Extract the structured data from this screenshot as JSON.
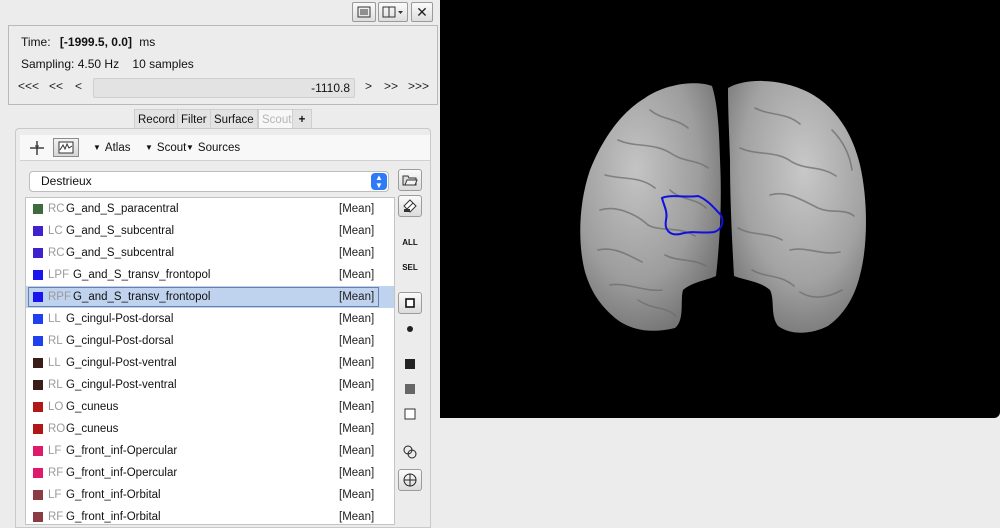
{
  "time_panel": {
    "time_label": "Time:",
    "time_value": "[-1999.5, 0.0]",
    "time_unit": "ms",
    "sampling_label": "Sampling:",
    "sampling_value": "4.50 Hz",
    "samples_value": "10 samples",
    "nav_buttons": [
      "<<<",
      "<<",
      "<",
      ">",
      ">>",
      ">>>"
    ],
    "current_time": "-1110.8"
  },
  "tabs": [
    {
      "label": "Record",
      "active": false
    },
    {
      "label": "Filter",
      "active": false
    },
    {
      "label": "Surface",
      "active": false
    },
    {
      "label": "Scout",
      "active": true
    },
    {
      "label": "+",
      "active": false
    }
  ],
  "scout_toolbar": {
    "atlas_menu": "Atlas",
    "scout_menu": "Scout",
    "sources_menu": "Sources"
  },
  "atlas_select": {
    "value": "Destrieux"
  },
  "side_buttons": {
    "all_label": "ALL",
    "sel_label": "SEL"
  },
  "scouts": [
    {
      "code": "RC",
      "name": "G_and_S_paracentral",
      "func": "[Mean]",
      "color": "#3e6a3e",
      "selected": false
    },
    {
      "code": "LC",
      "name": "G_and_S_subcentral",
      "func": "[Mean]",
      "color": "#4022cc",
      "selected": false
    },
    {
      "code": "RC",
      "name": "G_and_S_subcentral",
      "func": "[Mean]",
      "color": "#4022cc",
      "selected": false
    },
    {
      "code": "LPF",
      "name": "G_and_S_transv_frontopol",
      "func": "[Mean]",
      "color": "#1a14f0",
      "selected": false
    },
    {
      "code": "RPF",
      "name": "G_and_S_transv_frontopol",
      "func": "[Mean]",
      "color": "#1a14f0",
      "selected": true
    },
    {
      "code": "LL",
      "name": "G_cingul-Post-dorsal",
      "func": "[Mean]",
      "color": "#2040f0",
      "selected": false
    },
    {
      "code": "RL",
      "name": "G_cingul-Post-dorsal",
      "func": "[Mean]",
      "color": "#2040f0",
      "selected": false
    },
    {
      "code": "LL",
      "name": "G_cingul-Post-ventral",
      "func": "[Mean]",
      "color": "#3a1c18",
      "selected": false
    },
    {
      "code": "RL",
      "name": "G_cingul-Post-ventral",
      "func": "[Mean]",
      "color": "#3a1c18",
      "selected": false
    },
    {
      "code": "LO",
      "name": "G_cuneus",
      "func": "[Mean]",
      "color": "#b01818",
      "selected": false
    },
    {
      "code": "RO",
      "name": "G_cuneus",
      "func": "[Mean]",
      "color": "#b01818",
      "selected": false
    },
    {
      "code": "LF",
      "name": "G_front_inf-Opercular",
      "func": "[Mean]",
      "color": "#e01a6a",
      "selected": false
    },
    {
      "code": "RF",
      "name": "G_front_inf-Opercular",
      "func": "[Mean]",
      "color": "#e01a6a",
      "selected": false
    },
    {
      "code": "LF",
      "name": "G_front_inf-Orbital",
      "func": "[Mean]",
      "color": "#8a3c42",
      "selected": false
    },
    {
      "code": "RF",
      "name": "G_front_inf-Orbital",
      "func": "[Mean]",
      "color": "#8a3c42",
      "selected": false
    }
  ],
  "colors": {
    "selection_bg": "#bfd3ee",
    "scout_outline": "#1010e0",
    "view_background": "#000000",
    "brain_surface": "#9a9a9a"
  }
}
